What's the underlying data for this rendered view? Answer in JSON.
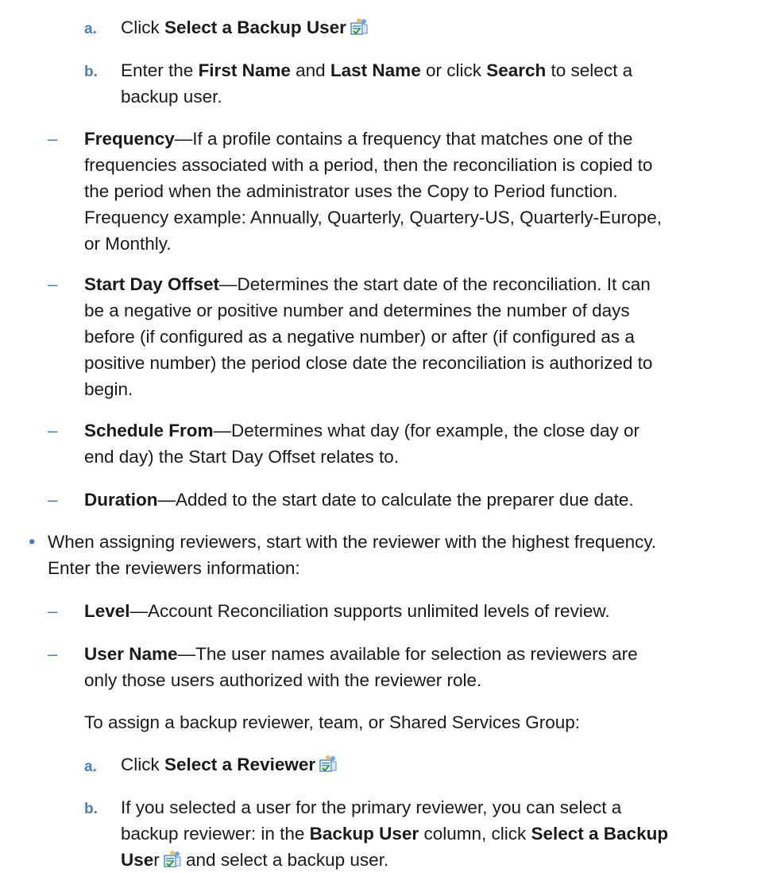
{
  "icon_name": "select-user-icon",
  "step_a1": {
    "marker": "a.",
    "pre": "Click ",
    "bold": "Select a Backup User"
  },
  "step_b1": {
    "marker": "b.",
    "t1": "Enter the ",
    "b1": "First Name",
    "t2": " and ",
    "b2": "Last Name",
    "t3": " or click ",
    "b3": "Search",
    "t4": " to select a",
    "line2": "backup user."
  },
  "dash": "–",
  "bullet": "•",
  "frequency": {
    "term": "Frequency",
    "l1": "—If a profile contains a frequency that matches one of the",
    "l2": "frequencies associated with a period, then the reconciliation is copied to",
    "l3": "the period when the administrator uses the Copy to Period function.",
    "l4": "Frequency example: Annually, Quarterly, Quartery-US, Quarterly-Europe,",
    "l5": "or Monthly."
  },
  "start_day_offset": {
    "term": "Start Day Offset",
    "l1": "—Determines the start date of the reconciliation. It can",
    "l2": "be a negative or positive number and determines the number of days",
    "l3": "before (if configured as a negative number) or after (if configured as a",
    "l4": "positive number) the period close date the reconciliation is authorized to",
    "l5": "begin."
  },
  "schedule_from": {
    "term": "Schedule From",
    "l1": "—Determines what day (for example, the close day or",
    "l2": "end day) the Start Day Offset relates to."
  },
  "duration": {
    "term": "Duration",
    "l1": "—Added to the start date to calculate the preparer due date."
  },
  "reviewers_bullet": {
    "l1": "When assigning reviewers, start with the reviewer with the highest frequency.",
    "l2": "Enter the reviewers information:"
  },
  "level": {
    "term": "Level",
    "l1": "—Account Reconciliation supports unlimited levels of review."
  },
  "user_name": {
    "term": "User Name",
    "l1": "—The user names available for selection as reviewers are",
    "l2": "only those users authorized with the reviewer role."
  },
  "assign_para": "To assign a backup reviewer, team, or Shared Services Group:",
  "step_a2": {
    "marker": "a.",
    "pre": "Click ",
    "bold": "Select a Reviewer"
  },
  "step_b2": {
    "marker": "b.",
    "l1": "If you selected a user for the primary reviewer, you can select a",
    "l2_t1": "backup reviewer: in the ",
    "l2_b1": "Backup User",
    "l2_t2": " column, click ",
    "l2_b2": "Select a Backup",
    "l3_b": "Use",
    "l3_r": "r",
    "l3_t": " and select a backup user."
  }
}
